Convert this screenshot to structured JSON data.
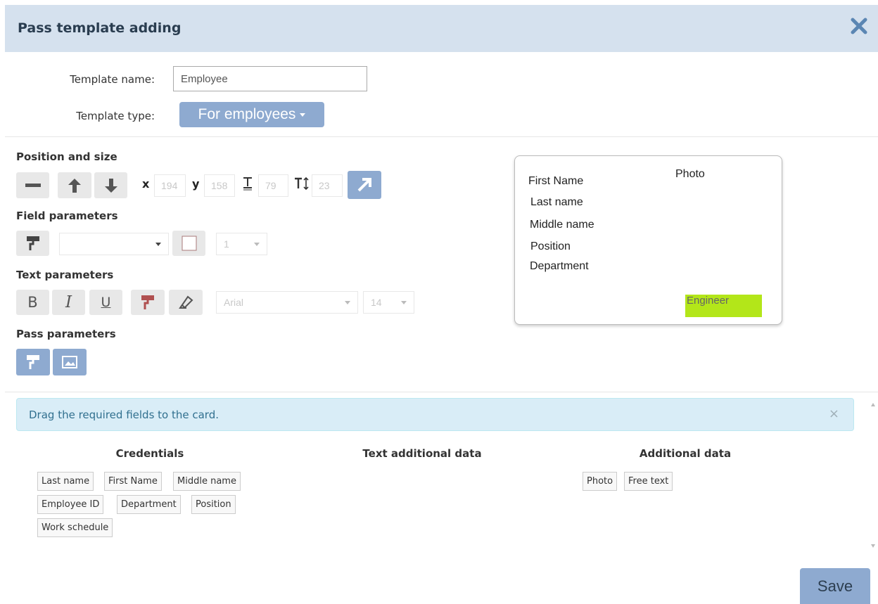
{
  "dialog": {
    "title": "Pass template adding"
  },
  "form": {
    "name_label": "Template name:",
    "name_value": "Employee",
    "type_label": "Template type:",
    "type_value": "For employees"
  },
  "position": {
    "heading": "Position and size",
    "x_label": "x",
    "x_value": "194",
    "y_label": "y",
    "y_value": "158",
    "w_value": "79",
    "h_value": "23"
  },
  "field_params": {
    "heading": "Field parameters",
    "border_width": "1"
  },
  "text_params": {
    "heading": "Text parameters",
    "bold": "B",
    "italic": "I",
    "underline": "U",
    "font": "Arial",
    "size": "14"
  },
  "pass_params": {
    "heading": "Pass parameters"
  },
  "card": {
    "fields": [
      "First Name",
      "Photo",
      "Last name",
      "Middle name",
      "Position",
      "Department"
    ],
    "highlight": "Engineer",
    "highlight_color": "#b3e619"
  },
  "alert": {
    "text": "Drag the required fields to the card.",
    "close": "×"
  },
  "columns": {
    "credentials": {
      "title": "Credentials",
      "chips": [
        "Last name",
        "First Name",
        "Middle name",
        "Employee ID",
        "Department",
        "Position",
        "Work schedule"
      ]
    },
    "text_additional": {
      "title": "Text additional data"
    },
    "additional": {
      "title": "Additional data",
      "chips": [
        "Photo",
        "Free text"
      ]
    }
  },
  "footer": {
    "save": "Save"
  },
  "colors": {
    "header_bg": "#d5e1ee",
    "accent": "#8eaad0",
    "alert_bg": "#d9edf7"
  }
}
